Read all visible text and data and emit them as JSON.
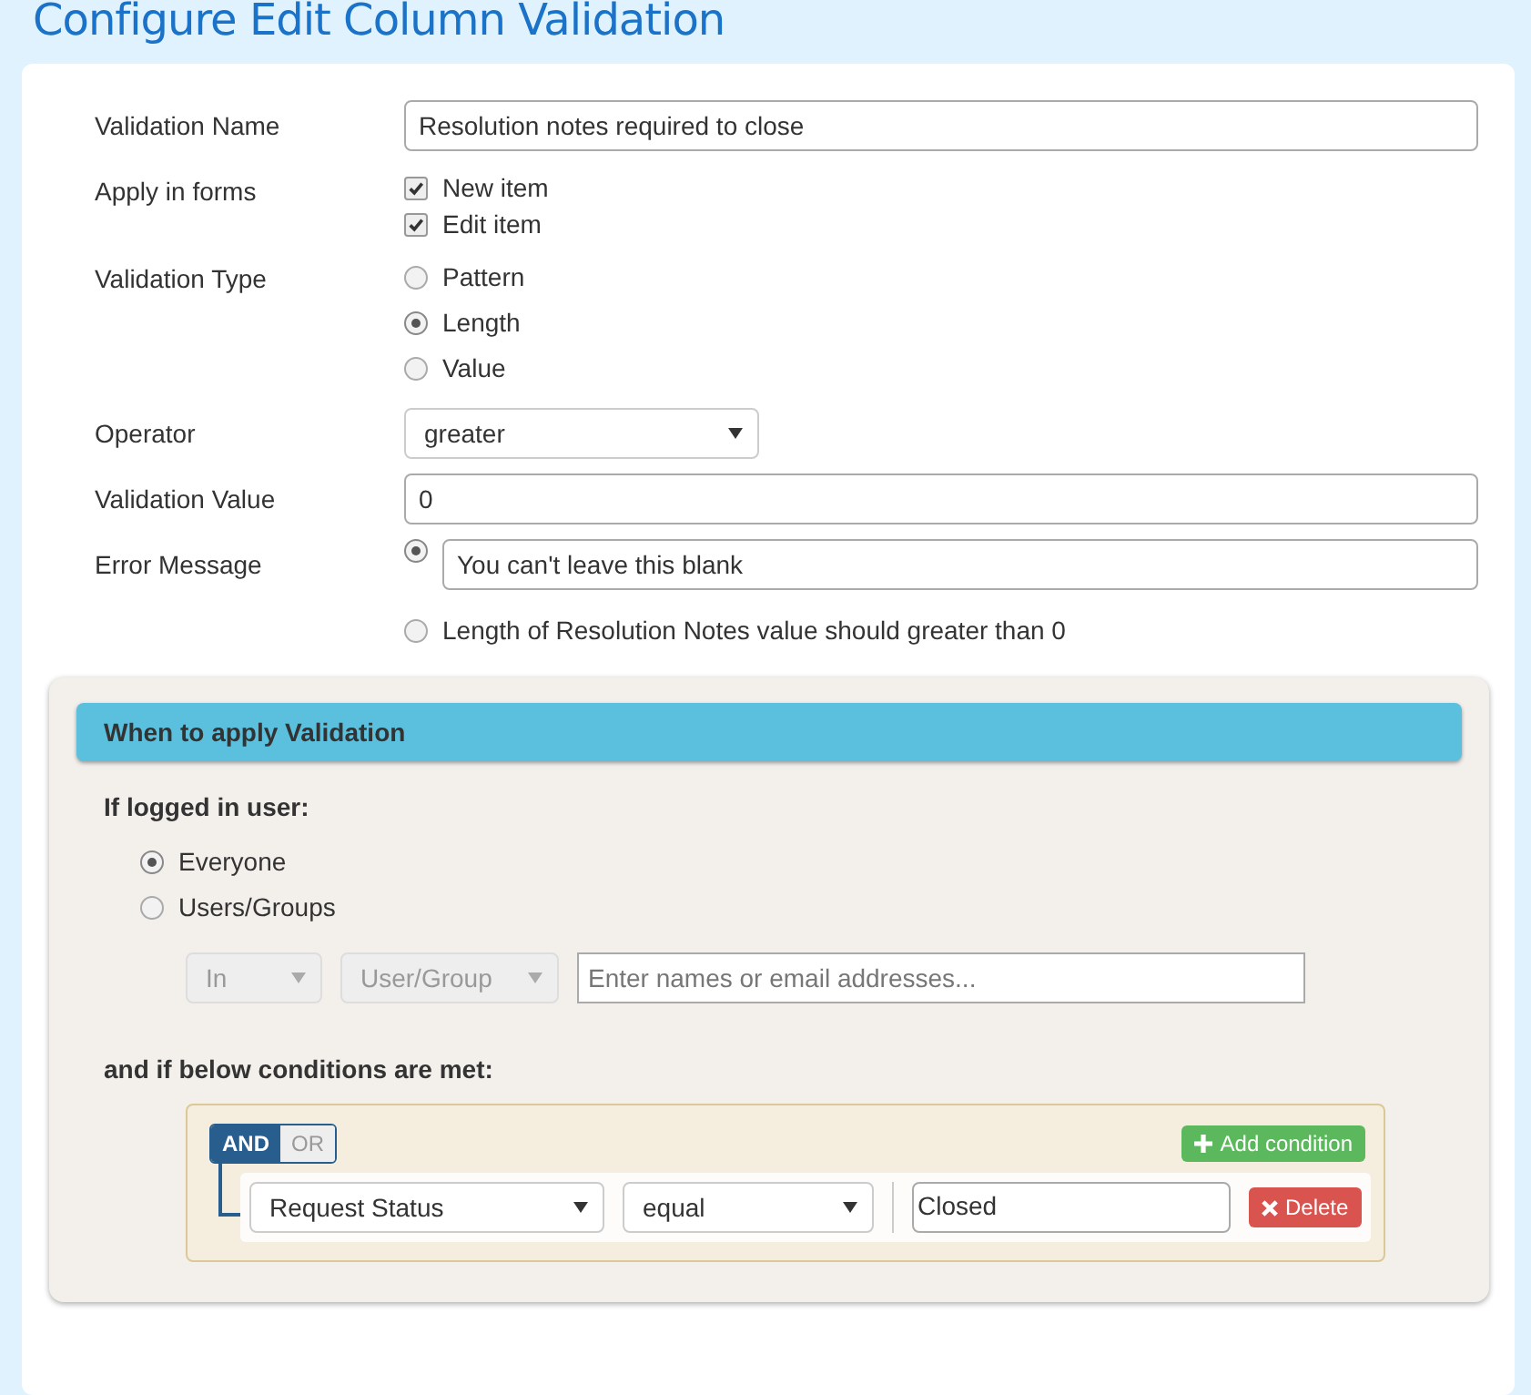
{
  "title": "Configure Edit Column Validation",
  "validation_name": {
    "label": "Validation Name",
    "value": "Resolution notes required to close"
  },
  "apply_in_forms": {
    "label": "Apply in forms",
    "options": [
      {
        "label": "New item",
        "checked": true
      },
      {
        "label": "Edit item",
        "checked": true
      }
    ]
  },
  "validation_type": {
    "label": "Validation Type",
    "options": [
      {
        "label": "Pattern",
        "selected": false
      },
      {
        "label": "Length",
        "selected": true
      },
      {
        "label": "Value",
        "selected": false
      }
    ]
  },
  "operator": {
    "label": "Operator",
    "value": "greater"
  },
  "validation_value": {
    "label": "Validation Value",
    "value": "0"
  },
  "error_message": {
    "label": "Error Message",
    "options": [
      {
        "kind": "input",
        "value": "You can't leave this blank",
        "selected": true
      },
      {
        "kind": "text",
        "label": "Length of Resolution Notes value should greater than 0",
        "selected": false
      }
    ]
  },
  "when_panel": {
    "header": "When to apply Validation",
    "user_label": "If logged in user:",
    "user_options": [
      {
        "label": "Everyone",
        "selected": true
      },
      {
        "label": "Users/Groups",
        "selected": false
      }
    ],
    "in_select": {
      "value": "In",
      "disabled": true
    },
    "group_select": {
      "value": "User/Group",
      "disabled": true
    },
    "people_field": {
      "placeholder": "Enter names or email addresses..."
    },
    "conditions_label": "and if below conditions are met:",
    "logic": [
      {
        "label": "AND",
        "selected": true
      },
      {
        "label": "OR",
        "selected": false
      }
    ],
    "add_button": "Add condition",
    "conditions": [
      {
        "field": "Request Status",
        "operator": "equal",
        "value": "Closed",
        "delete": "Delete"
      }
    ]
  }
}
